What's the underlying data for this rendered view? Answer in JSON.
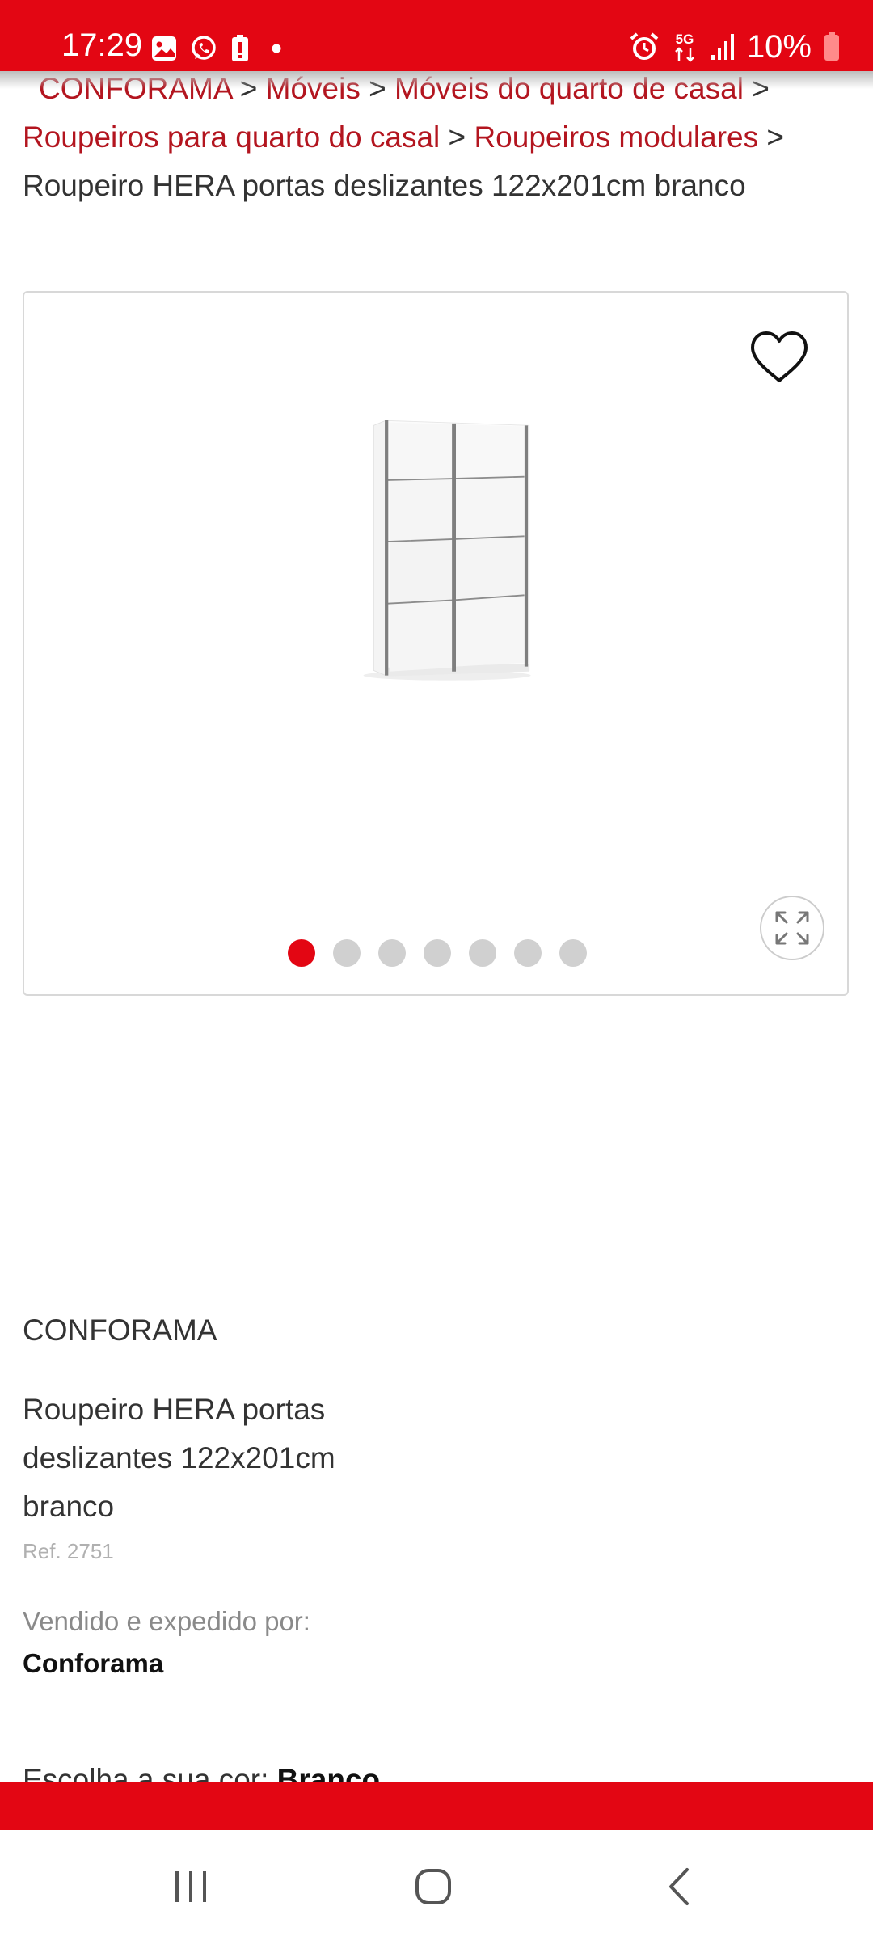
{
  "status_bar": {
    "time": "17:29",
    "network": "5G",
    "battery": "10%",
    "icons_left": [
      "gallery-icon",
      "whatsapp-icon",
      "battery-alert-icon",
      "dot-icon"
    ],
    "icons_right": [
      "alarm-icon",
      "5g-data-icon",
      "signal-icon",
      "battery-low-icon"
    ]
  },
  "breadcrumb": {
    "items": [
      "CONFORAMA",
      "Móveis",
      "Móveis do quarto de casal",
      "Roupeiros para quarto do casal",
      "Roupeiros modulares"
    ],
    "separator": ">",
    "current": "Roupeiro HERA portas deslizantes 122x201cm branco"
  },
  "gallery": {
    "image_count": 7,
    "active_index": 0,
    "wishlist_icon": "heart-outline-icon",
    "expand_icon": "expand-icon"
  },
  "product": {
    "brand": "CONFORAMA",
    "title": "Roupeiro HERA portas deslizantes 122x201cm branco",
    "ref": "Ref. 2751",
    "sold_by_label": "Vendido e expedido por:",
    "seller": "Conforama",
    "color_label": "Escolha a sua cor:",
    "color_value": "Branco"
  },
  "colors": {
    "brand_red": "#e30613",
    "link_red": "#b3151f",
    "text": "#333333",
    "muted": "#8a8a8a"
  },
  "nav_bar": {
    "buttons": [
      "recent-apps-icon",
      "home-icon",
      "back-icon"
    ]
  }
}
